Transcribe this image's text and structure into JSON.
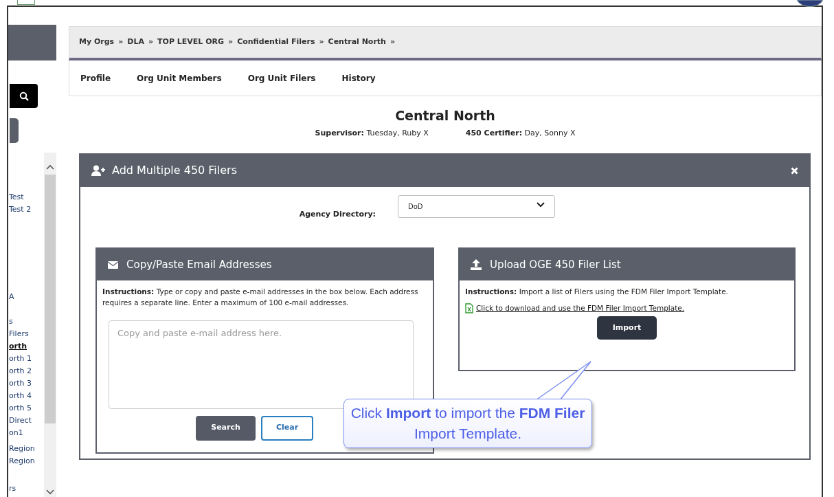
{
  "sidebar": {
    "items": [
      {
        "label": "Test",
        "selected": false
      },
      {
        "label": "Test 2",
        "selected": false
      },
      {
        "label": "A",
        "selected": false
      },
      {
        "label": "s",
        "selected": false
      },
      {
        "label": "Filers",
        "selected": false
      },
      {
        "label": "orth",
        "selected": true
      },
      {
        "label": "orth 1",
        "selected": false
      },
      {
        "label": "orth 2",
        "selected": false
      },
      {
        "label": "orth 3",
        "selected": false
      },
      {
        "label": "orth 4",
        "selected": false
      },
      {
        "label": "orth 5",
        "selected": false
      },
      {
        "label": "Direct",
        "selected": false
      },
      {
        "label": "on1",
        "selected": false
      },
      {
        "label": "Region",
        "selected": false
      },
      {
        "label": "Region",
        "selected": false
      },
      {
        "label": "rs",
        "selected": false
      }
    ]
  },
  "breadcrumb": {
    "separator": "»",
    "items": [
      "My Orgs",
      "DLA",
      "TOP LEVEL ORG",
      "Confidential Filers",
      "Central North"
    ]
  },
  "tabs": [
    "Profile",
    "Org Unit Members",
    "Org Unit Filers",
    "History"
  ],
  "org": {
    "title": "Central North",
    "supervisor_label": "Supervisor:",
    "supervisor": "Tuesday, Ruby X",
    "certifier_label": "450 Certifier:",
    "certifier": "Day, Sonny X"
  },
  "modal": {
    "title": "Add Multiple 450 Filers",
    "agency_label": "Agency Directory:",
    "agency_value": "DoD",
    "copy_panel": {
      "title": "Copy/Paste Email Addresses",
      "instructions": "**Instructions:** Type or copy and paste e-mail addresses in the box below. Each address requires a separate line. Enter a maximum of 100 e-mail addresses.",
      "placeholder": "Copy and paste e-mail address here.",
      "buttons": [
        {
          "label": "Search",
          "kind": "solid"
        },
        {
          "label": "Clear",
          "kind": "outline"
        }
      ]
    },
    "upload_panel": {
      "title": "Upload OGE 450 Filer List",
      "instructions": "**Instructions:** Import a list of Filers using the FDM Filer Import Template.",
      "link": "Click to download and use the FDM Filer Import Template.",
      "button": "Import"
    }
  },
  "callout": {
    "text": "Click **Import** to import the **FDM Filer** Import Template."
  }
}
